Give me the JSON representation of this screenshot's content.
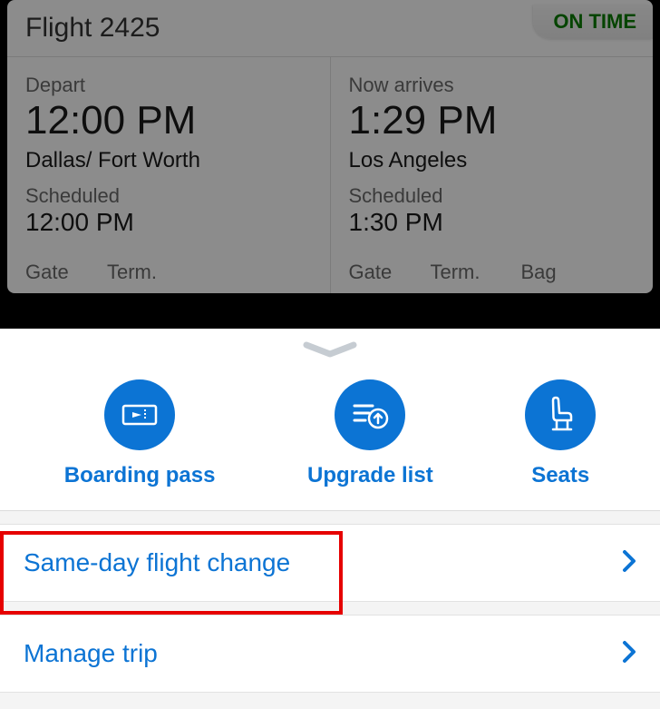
{
  "flight": {
    "title": "Flight 2425",
    "status": "ON TIME",
    "depart": {
      "label": "Depart",
      "time": "12:00 PM",
      "city": "Dallas/ Fort Worth",
      "sched_label": "Scheduled",
      "sched_time": "12:00 PM",
      "meta": {
        "gate_label": "Gate",
        "term_label": "Term."
      }
    },
    "arrive": {
      "label": "Now arrives",
      "time": "1:29 PM",
      "city": "Los Angeles",
      "sched_label": "Scheduled",
      "sched_time": "1:30 PM",
      "meta": {
        "gate_label": "Gate",
        "term_label": "Term.",
        "bag_label": "Bag"
      }
    }
  },
  "actions": {
    "boarding_pass": "Boarding pass",
    "upgrade_list": "Upgrade list",
    "seats": "Seats"
  },
  "menu": {
    "same_day": "Same-day flight change",
    "manage_trip": "Manage trip"
  },
  "colors": {
    "brand_blue": "#0c74d4",
    "status_green": "#0a7d00",
    "highlight_red": "#e60000"
  }
}
